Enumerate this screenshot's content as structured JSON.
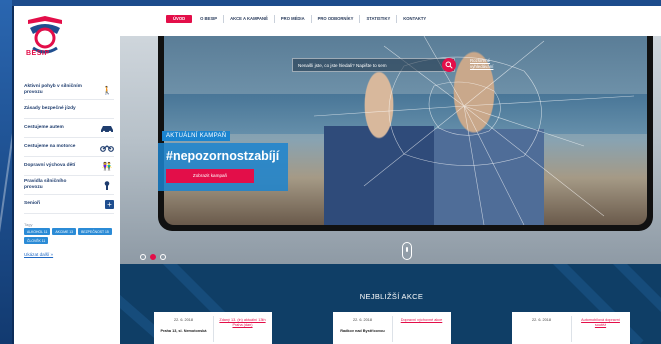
{
  "brand": {
    "name": "BESIP",
    "accent": "#e30e49",
    "navy": "#1f3d6e",
    "blue": "#1b84cf"
  },
  "topnav": {
    "items": [
      {
        "label": "ÚVOD"
      },
      {
        "label": "O BESIP"
      },
      {
        "label": "AKCE A KAMPANĚ"
      },
      {
        "label": "PRO MÉDIA"
      },
      {
        "label": "PRO ODBORNÍKY"
      },
      {
        "label": "STATISTIKY"
      },
      {
        "label": "KONTAKTY"
      }
    ]
  },
  "sidebar": {
    "items": [
      {
        "label": "Aktivní pohyb v silničním provozu",
        "icon": "pedestrian-icon"
      },
      {
        "label": "Zásady bezpečné jízdy",
        "icon": ""
      },
      {
        "label": "Cestujeme autem",
        "icon": "car-icon"
      },
      {
        "label": "Cestujeme na motorce",
        "icon": "motorcycle-icon"
      },
      {
        "label": "Dopravní výchova dětí",
        "icon": "children-icon"
      },
      {
        "label": "Pravidla silničního provozu",
        "icon": "traffic-sign-icon"
      },
      {
        "label": "Senioři",
        "icon": "plus-icon"
      }
    ],
    "tags_title": "Tagy",
    "tags": [
      "ALKOHOL 11",
      "AKCIME 13",
      "BEZPEČNOST 15",
      "ČLOVĚK 11"
    ],
    "more_link": "Ukázat další »"
  },
  "hero": {
    "search_placeholder": "Nenašli jste, co jste hledali? Napište to sem",
    "advanced_search": "Rozšířené vyhledávání",
    "campaign_label": "AKTUÁLNÍ KAMPAŇ",
    "hashtag": "#nepozornostzabíjí",
    "cta_label": "Zobrazit kampaň",
    "slides": {
      "count": 3,
      "active": 2
    }
  },
  "events": {
    "title": "NEJBLIŽŠÍ AKCE",
    "cards": [
      {
        "date": "22. 6. 2018",
        "place": "Praha 13, sl. Nemotonská",
        "link": "Zdaný 13. (in) aktuální 13th Praha (dan)"
      },
      {
        "date": "22. 6. 2018",
        "place": "Radkov nad Bystřicovou",
        "link": "Dopravní výchovné akce"
      },
      {
        "date": "22. 6. 2018",
        "place": "",
        "link": "Automobilová dopravní soutěž"
      }
    ]
  }
}
